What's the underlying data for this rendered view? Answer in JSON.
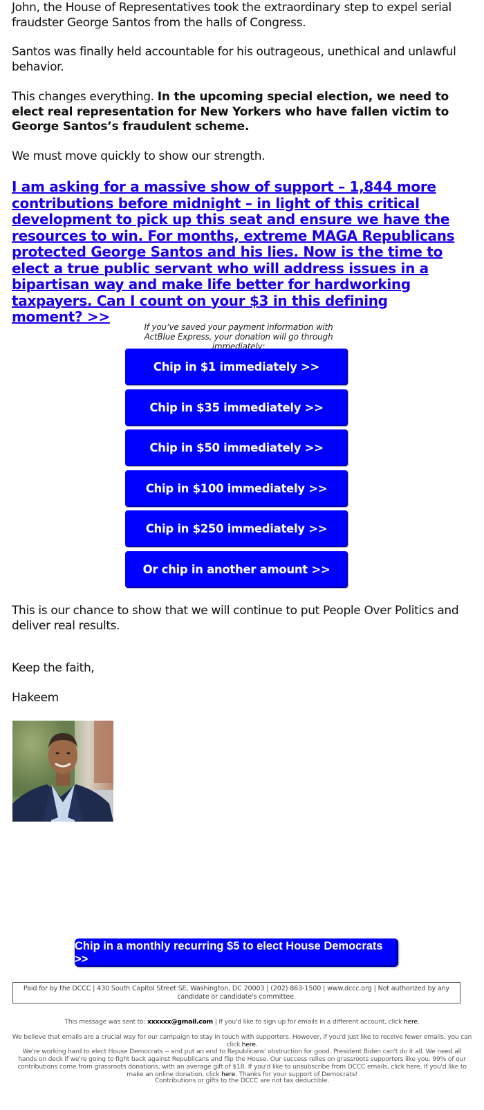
{
  "email": {
    "greeting_paragraph": "John, the House of Representatives took the extraordinary step to expel serial fraudster George Santos from the halls of Congress.",
    "paragraph_2": "Santos was finally held accountable for his outrageous, unethical and unlawful behavior.",
    "paragraph_3_lead": "This changes everything. ",
    "paragraph_3_bold": "In the upcoming special election, we need to elect real representation for New Yorkers who have fallen victim to George Santos’s fraudulent scheme.",
    "paragraph_4": "We must move quickly to show our strength.",
    "cta_link": "I am asking for a massive show of support – 1,844 more contributions before midnight – in light of this critical development to pick up this seat and ensure we have the resources to win. For months, extreme MAGA Republicans protected George Santos and his lies. Now is the time to elect a true public servant who will address issues in a bipartisan way and make life better for hardworking taxpayers. Can I count on your $3 in this defining moment? >>",
    "actblue_note": "If you’ve saved your payment information with ActBlue Express, your donation will go through immediately:",
    "donation_buttons": [
      {
        "label": "Chip in $1 immediately >>"
      },
      {
        "label": "Chip in $35 immediately >>"
      },
      {
        "label": "Chip in $50 immediately >>"
      },
      {
        "label": "Chip in $100 immediately >>"
      },
      {
        "label": "Chip in $250 immediately >>"
      },
      {
        "label": "Or chip in another amount >>"
      }
    ],
    "paragraph_5": "This is our chance to show that we will continue to put People Over Politics and deliver real results.",
    "signoff": "Keep the faith,",
    "signature": "Hakeem",
    "portrait_alt": "Portrait photo of Hakeem",
    "monthly_button": "Chip in a monthly recurring $5 to elect House Democrats >>"
  },
  "footer": {
    "paid_for": "Paid for by the DCCC | 430 South Capitol Street SE, Washington, DC 20003 | (202) 863-1500 | www.dccc.org | Not authorized by any candidate or candidate's committee.",
    "sent_to_prefix": "This message was sent to: ",
    "sent_to_email": "xxxxxx@gmail.com",
    "sent_to_suffix": " | If you'd like to sign up for emails in a different account, click ",
    "here_label": "here",
    "period": ".",
    "fewer_emails": "We believe that emails are a crucial way for our campaign to stay in touch with supporters. However, if you'd just like to receive fewer emails, you can click ",
    "mission_text": "We're working hard to elect House Democrats -- and put an end to Republicans' obstruction for good. President Biden can't do it all. We need all hands on deck if we're going to fight back against Republicans and flip the House. Our success relies on grassroots supporters like you. 99% of our contributions come from grassroots donations, with an average gift of $18. If you'd like to unsubscribe from DCCC emails, click here. If you'd like to make an online donation, click ",
    "mission_suffix": ". Thanks for your support of Democrats!",
    "tax_note": "Contributions or gifts to the DCCC are not tax deductible."
  },
  "colors": {
    "button_blue": "#0000ff",
    "link_blue": "#1a00e8",
    "text": "#111111",
    "footer_text": "#555555"
  }
}
